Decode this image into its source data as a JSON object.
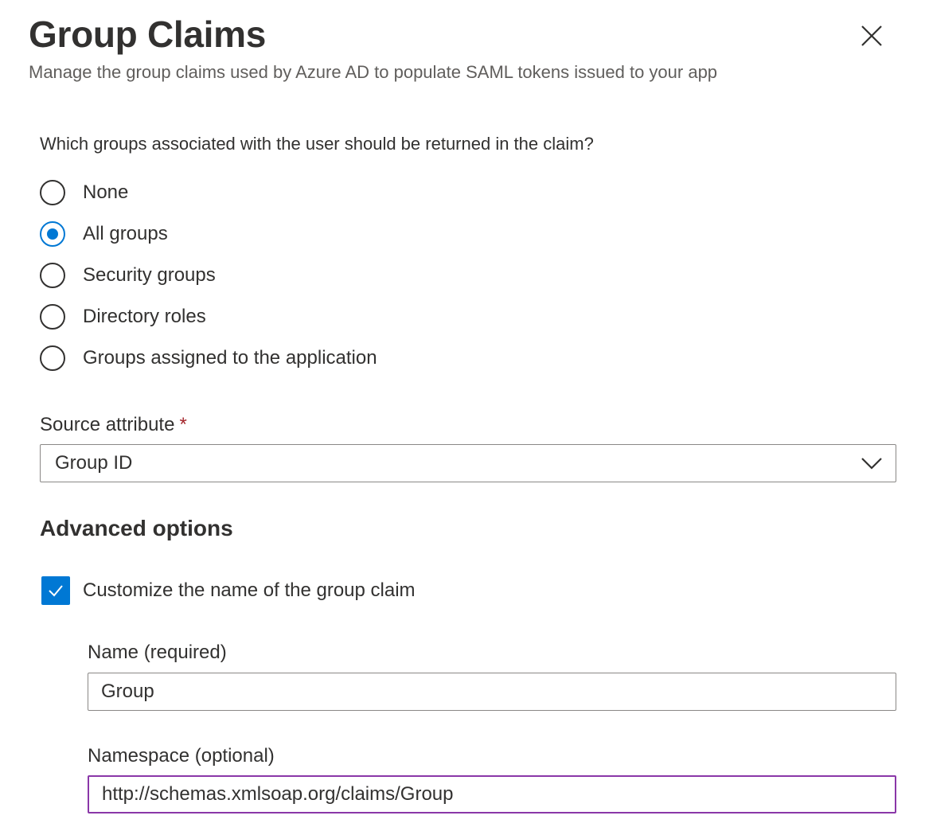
{
  "panel": {
    "title": "Group Claims",
    "subtitle": "Manage the group claims used by Azure AD to populate SAML tokens issued to your app",
    "close_icon": "close-icon"
  },
  "groups": {
    "question": "Which groups associated with the user should be returned in the claim?",
    "options": [
      {
        "label": "None",
        "selected": false
      },
      {
        "label": "All groups",
        "selected": true
      },
      {
        "label": "Security groups",
        "selected": false
      },
      {
        "label": "Directory roles",
        "selected": false
      },
      {
        "label": "Groups assigned to the application",
        "selected": false
      }
    ]
  },
  "source_attribute": {
    "label": "Source attribute",
    "required_marker": "*",
    "value": "Group ID"
  },
  "advanced": {
    "heading": "Advanced options",
    "customize_label": "Customize the name of the group claim",
    "customize_checked": true,
    "name_label": "Name (required)",
    "name_value": "Group",
    "namespace_label": "Namespace (optional)",
    "namespace_value": "http://schemas.xmlsoap.org/claims/Group"
  },
  "colors": {
    "accent": "#0078d4",
    "focus_border": "#8a37a8",
    "required": "#a4262c",
    "text": "#323130",
    "secondary_text": "#605e5c"
  }
}
